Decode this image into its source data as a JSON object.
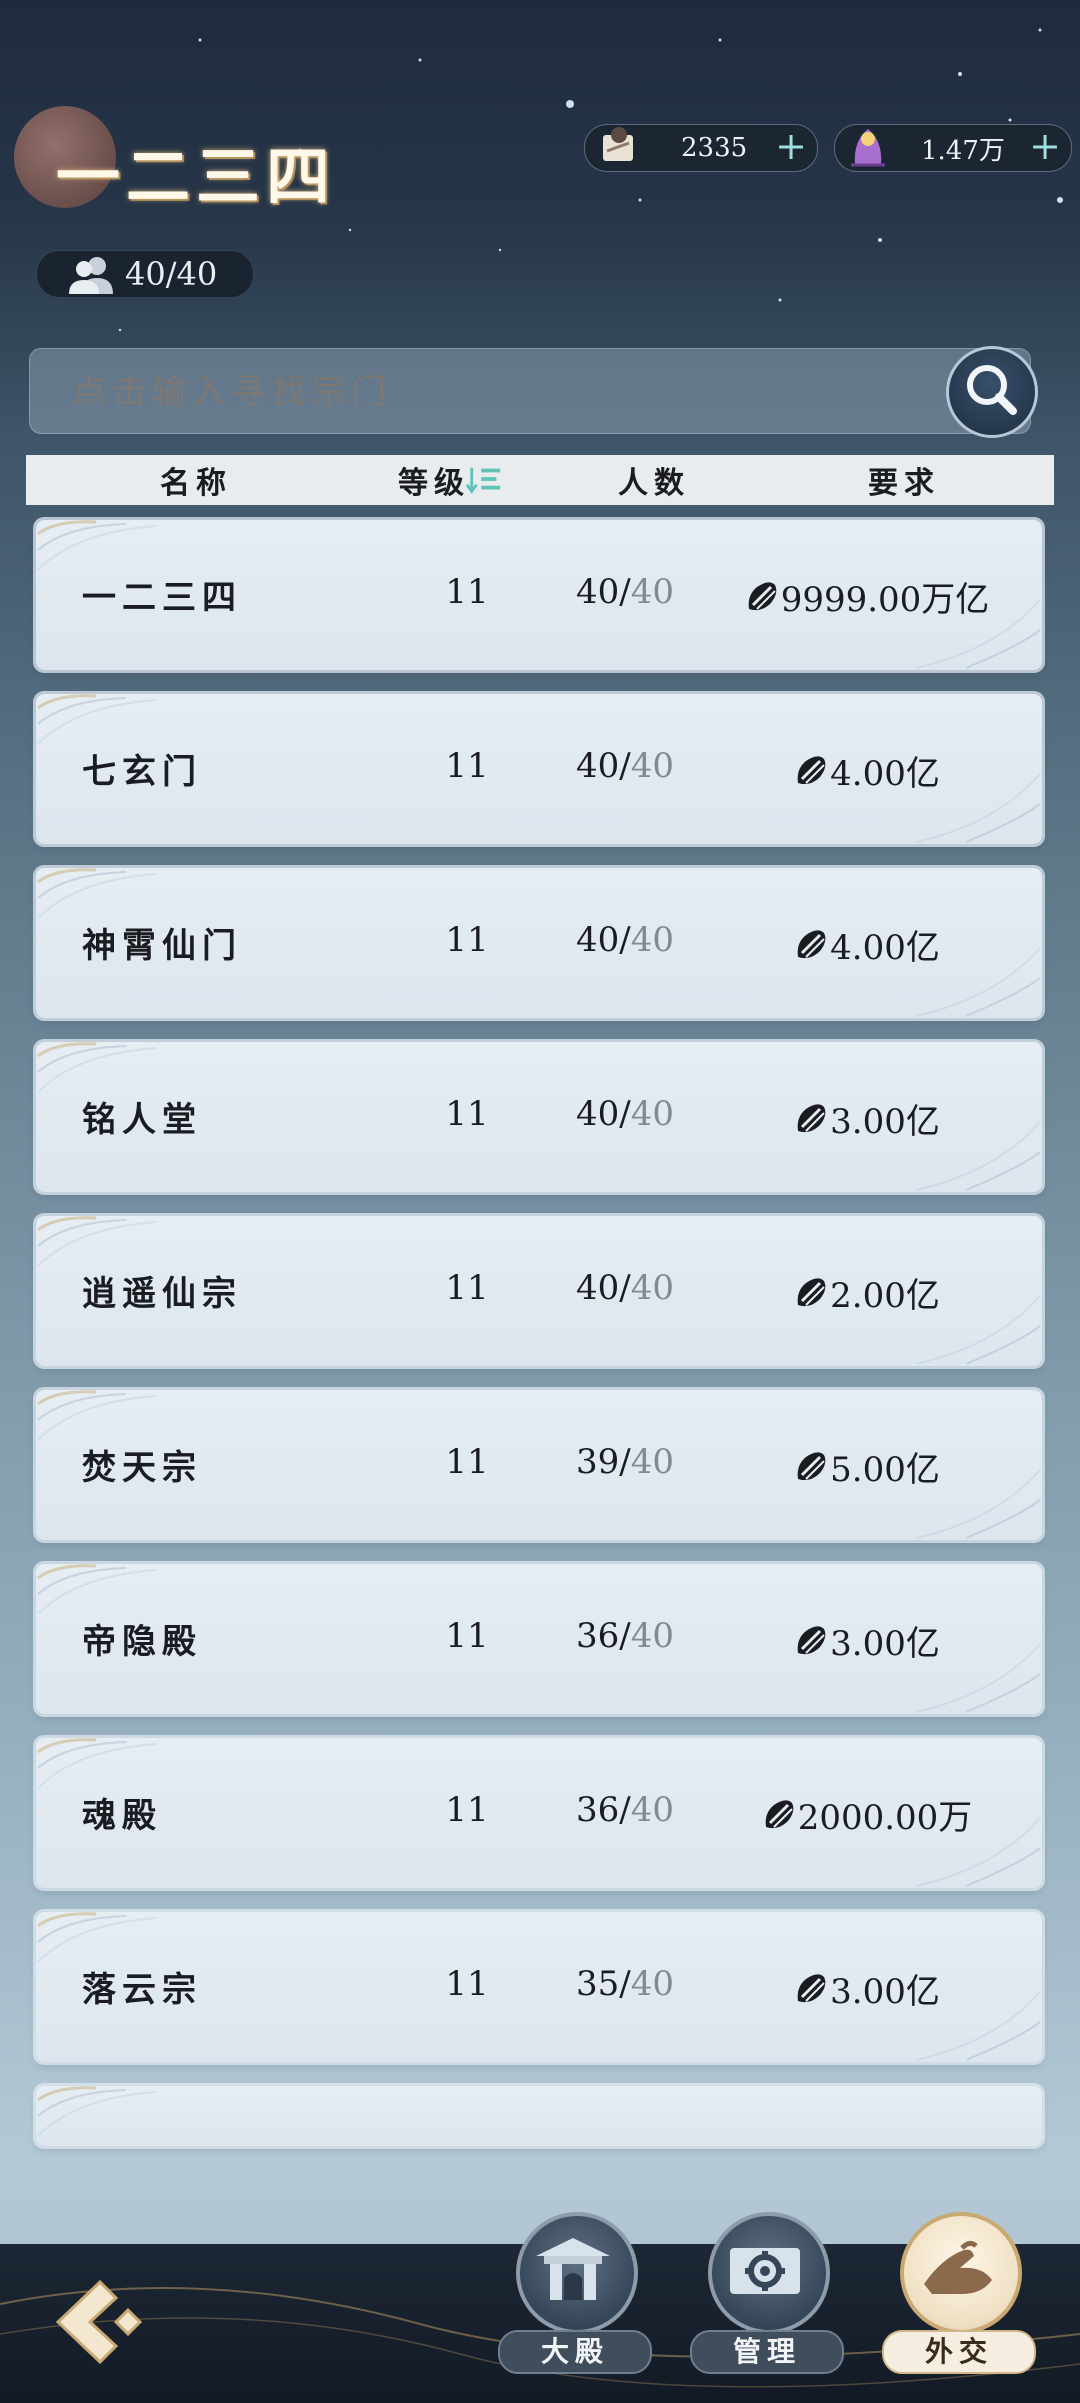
{
  "sect": {
    "title": "一二三四",
    "member_count": "40/40"
  },
  "resources": [
    {
      "icon": "scroll-character-icon",
      "value": "2335"
    },
    {
      "icon": "purple-spirit-icon",
      "value": "1.47万"
    }
  ],
  "search": {
    "placeholder": "点击输入寻找宗门"
  },
  "table": {
    "headers": {
      "name": "名称",
      "level": "等级",
      "members": "人数",
      "requirement": "要求"
    },
    "rows": [
      {
        "name": "一二三四",
        "level": "11",
        "members": "40",
        "capacity": "40",
        "requirement": "9999.00万亿"
      },
      {
        "name": "七玄门",
        "level": "11",
        "members": "40",
        "capacity": "40",
        "requirement": "4.00亿"
      },
      {
        "name": "神霄仙门",
        "level": "11",
        "members": "40",
        "capacity": "40",
        "requirement": "4.00亿"
      },
      {
        "name": "铭人堂",
        "level": "11",
        "members": "40",
        "capacity": "40",
        "requirement": "3.00亿"
      },
      {
        "name": "逍遥仙宗",
        "level": "11",
        "members": "40",
        "capacity": "40",
        "requirement": "2.00亿"
      },
      {
        "name": "焚天宗",
        "level": "11",
        "members": "39",
        "capacity": "40",
        "requirement": "5.00亿"
      },
      {
        "name": "帝隐殿",
        "level": "11",
        "members": "36",
        "capacity": "40",
        "requirement": "3.00亿"
      },
      {
        "name": "魂殿",
        "level": "11",
        "members": "36",
        "capacity": "40",
        "requirement": "2000.00万"
      },
      {
        "name": "落云宗",
        "level": "11",
        "members": "35",
        "capacity": "40",
        "requirement": "3.00亿"
      }
    ]
  },
  "nav": {
    "hall": "大殿",
    "manage": "管理",
    "diplomacy": "外交"
  },
  "colors": {
    "accent_teal": "#5fc4b8",
    "active_gold": "#c9a872"
  }
}
